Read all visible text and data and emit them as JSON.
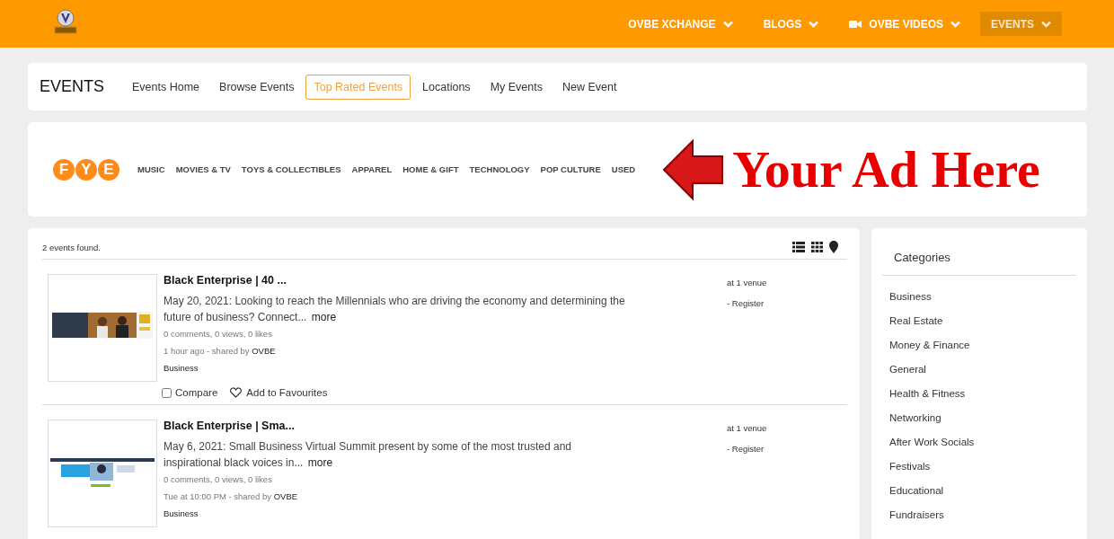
{
  "top_nav": [
    {
      "label": "OVBE XCHANGE",
      "kind": "plain",
      "selected": false
    },
    {
      "label": "BLOGS",
      "kind": "plain",
      "selected": false
    },
    {
      "label": "OVBE VIDEOS",
      "kind": "video",
      "selected": false
    },
    {
      "label": "EVENTS",
      "kind": "plain",
      "selected": true
    }
  ],
  "section": {
    "title": "EVENTS",
    "tabs": [
      {
        "label": "Events Home",
        "selected": false
      },
      {
        "label": "Browse Events",
        "selected": false
      },
      {
        "label": "Top Rated Events",
        "selected": true
      },
      {
        "label": "Locations",
        "selected": false
      },
      {
        "label": "My Events",
        "selected": false
      },
      {
        "label": "New Event",
        "selected": false
      }
    ]
  },
  "ad": {
    "logo": [
      "F",
      "Y",
      "E"
    ],
    "menu": [
      "MUSIC",
      "MOVIES & TV",
      "TOYS & COLLECTIBLES",
      "APPAREL",
      "HOME & GIFT",
      "TECHNOLOGY",
      "POP CULTURE",
      "USED"
    ],
    "headline": "Your Ad Here"
  },
  "results": {
    "count": "2 events found.",
    "events": [
      {
        "title": "Black Enterprise | 40 ...",
        "description": "May 20, 2021: Looking to reach the Millennials who are driving the economy and determining the future of business? Connect...",
        "more": "more",
        "stats": "0 comments, 0 views, 0 likes",
        "posted": "1 hour ago - shared by",
        "author": "OVBE",
        "category": "Business",
        "venue": "at 1 venue",
        "register": "- Register",
        "actions": {
          "compare": "Compare",
          "compare_checked": false,
          "favourite": "Add to Favourites"
        }
      },
      {
        "title": "Black Enterprise | Sma...",
        "description": "May 6, 2021: Small Business Virtual Summit present by some of the most trusted and inspirational black voices in...",
        "more": "more",
        "stats": "0 comments, 0 views, 0 likes",
        "posted": "Tue at 10:00 PM - shared by",
        "author": "OVBE",
        "category": "Business",
        "venue": "at 1 venue",
        "register": "- Register"
      }
    ]
  },
  "categories": {
    "title": "Categories",
    "items": [
      "Business",
      "Real Estate",
      "Money & Finance",
      "General",
      "Health & Fitness",
      "Networking",
      "After Work Socials",
      "Festivals",
      "Educational",
      "Fundraisers"
    ]
  }
}
